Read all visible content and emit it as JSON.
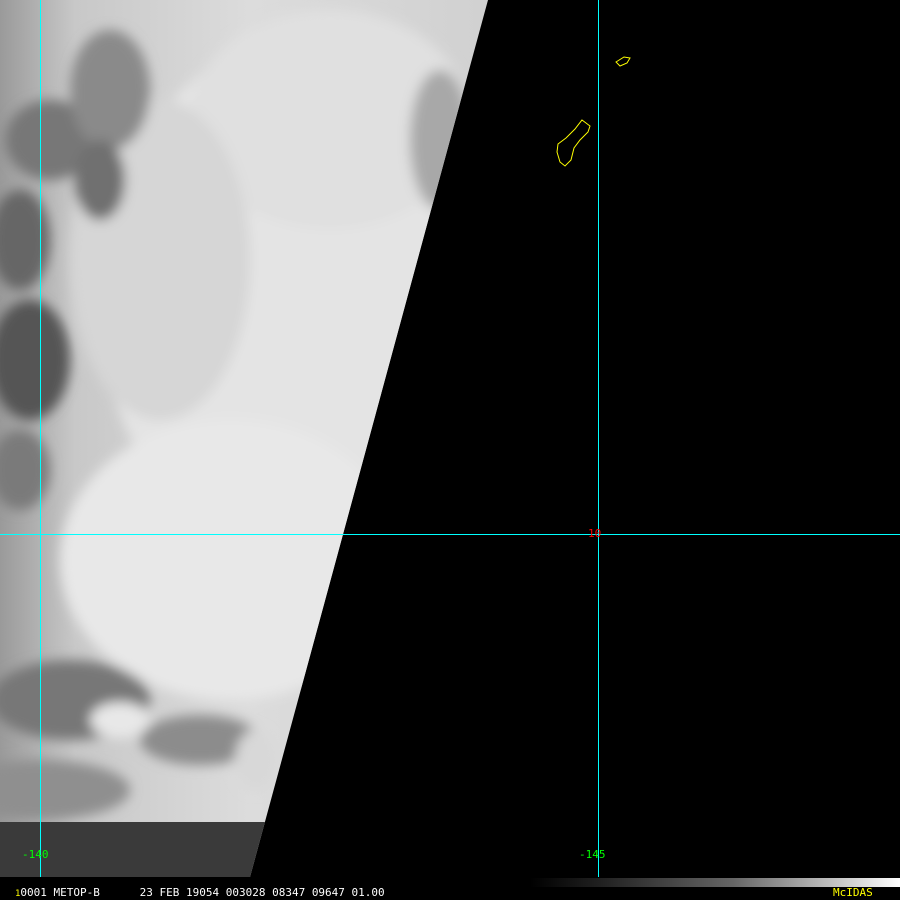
{
  "map": {
    "longitude_labels": [
      "-140",
      "-145"
    ],
    "latitude_labels": [
      "10"
    ],
    "colors": {
      "gridline": "#00ffff",
      "coastline": "#ffff00",
      "longitude_label": "#00ff00",
      "latitude_label": "#ff0000",
      "background": "#000000"
    }
  },
  "status_bar": {
    "frame_number": "1",
    "info": "0001 METOP-B      23 FEB 19054 003028 08347 09647 01.00",
    "brand": "McIDAS"
  }
}
